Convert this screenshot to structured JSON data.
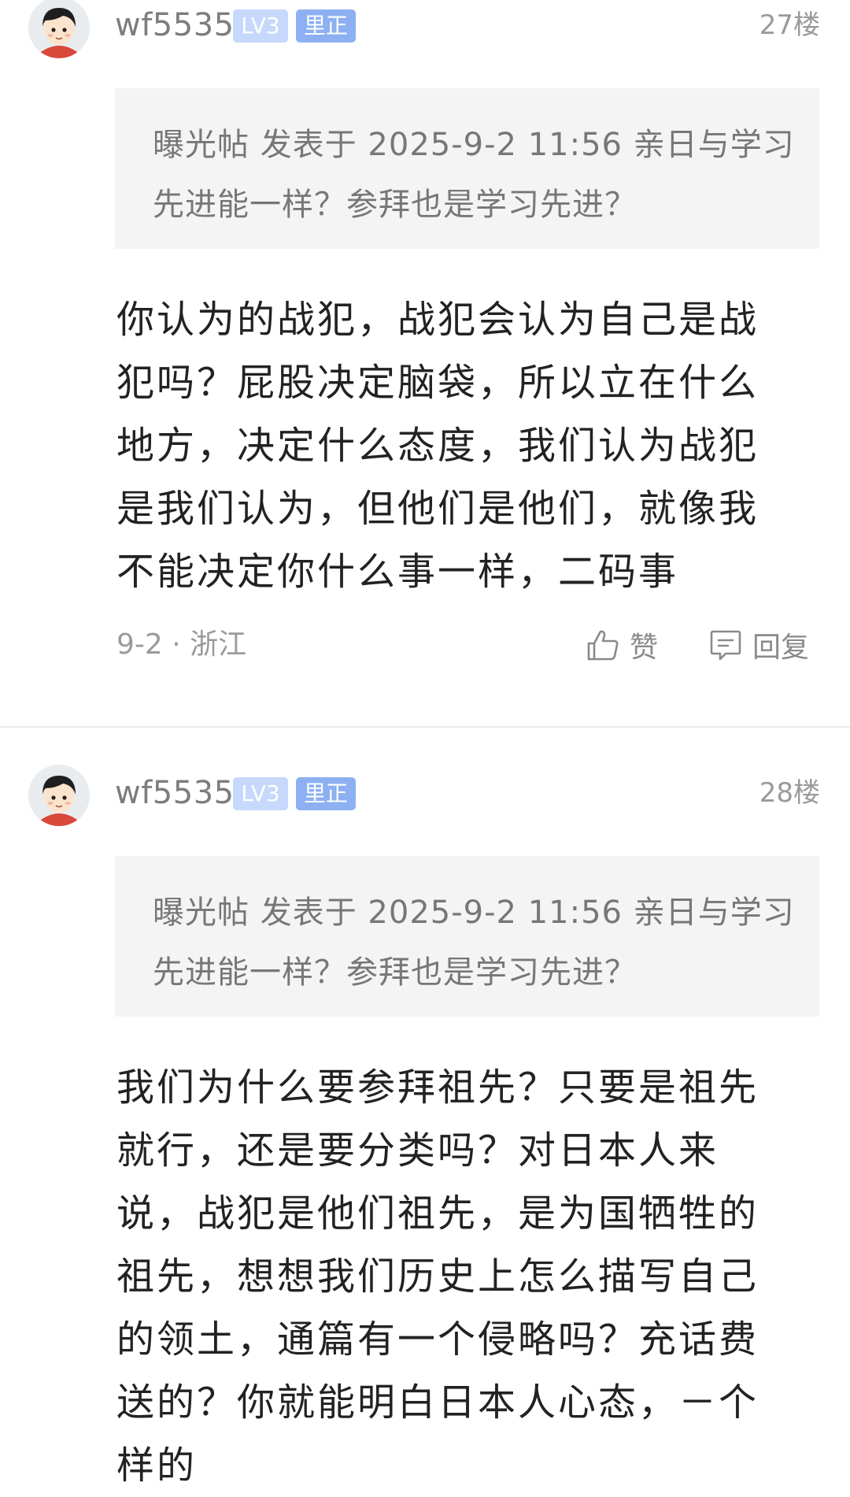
{
  "posts": [
    {
      "username": "wf5535",
      "level": "LV3",
      "tag": "里正",
      "floor": "27楼",
      "quote": "曝光帖 发表于 2025-9-2 11:56 亲日与学习先进能一样？参拜也是学习先进？",
      "content": "你认为的战犯，战犯会认为自己是战犯吗？屁股决定脑袋，所以立在什么地方，决定什么态度，我们认为战犯是我们认为，但他们是他们，就像我不能决定你什么事一样，二码事",
      "date": "9-2",
      "separator": "·",
      "location": "浙江",
      "like_label": "赞",
      "reply_label": "回复"
    },
    {
      "username": "wf5535",
      "level": "LV3",
      "tag": "里正",
      "floor": "28楼",
      "quote": "曝光帖 发表于 2025-9-2 11:56 亲日与学习先进能一样？参拜也是学习先进？",
      "content": "我们为什么要参拜祖先？只要是祖先就行，还是要分类吗？对日本人来说，战犯是他们祖先，是为国牺牲的祖先，想想我们历史上怎么描写自己的领土，通篇有一个侵略吗？充话费送的？你就能明白日本人心态，－个样的"
    }
  ],
  "icons": {
    "like": "thumbs-up-icon",
    "reply": "comment-icon",
    "avatar": "cartoon-avatar"
  },
  "colors": {
    "level_badge": "#c6d8fb",
    "tag_badge": "#8cb0f2",
    "quote_background": "#f4f4f4"
  }
}
